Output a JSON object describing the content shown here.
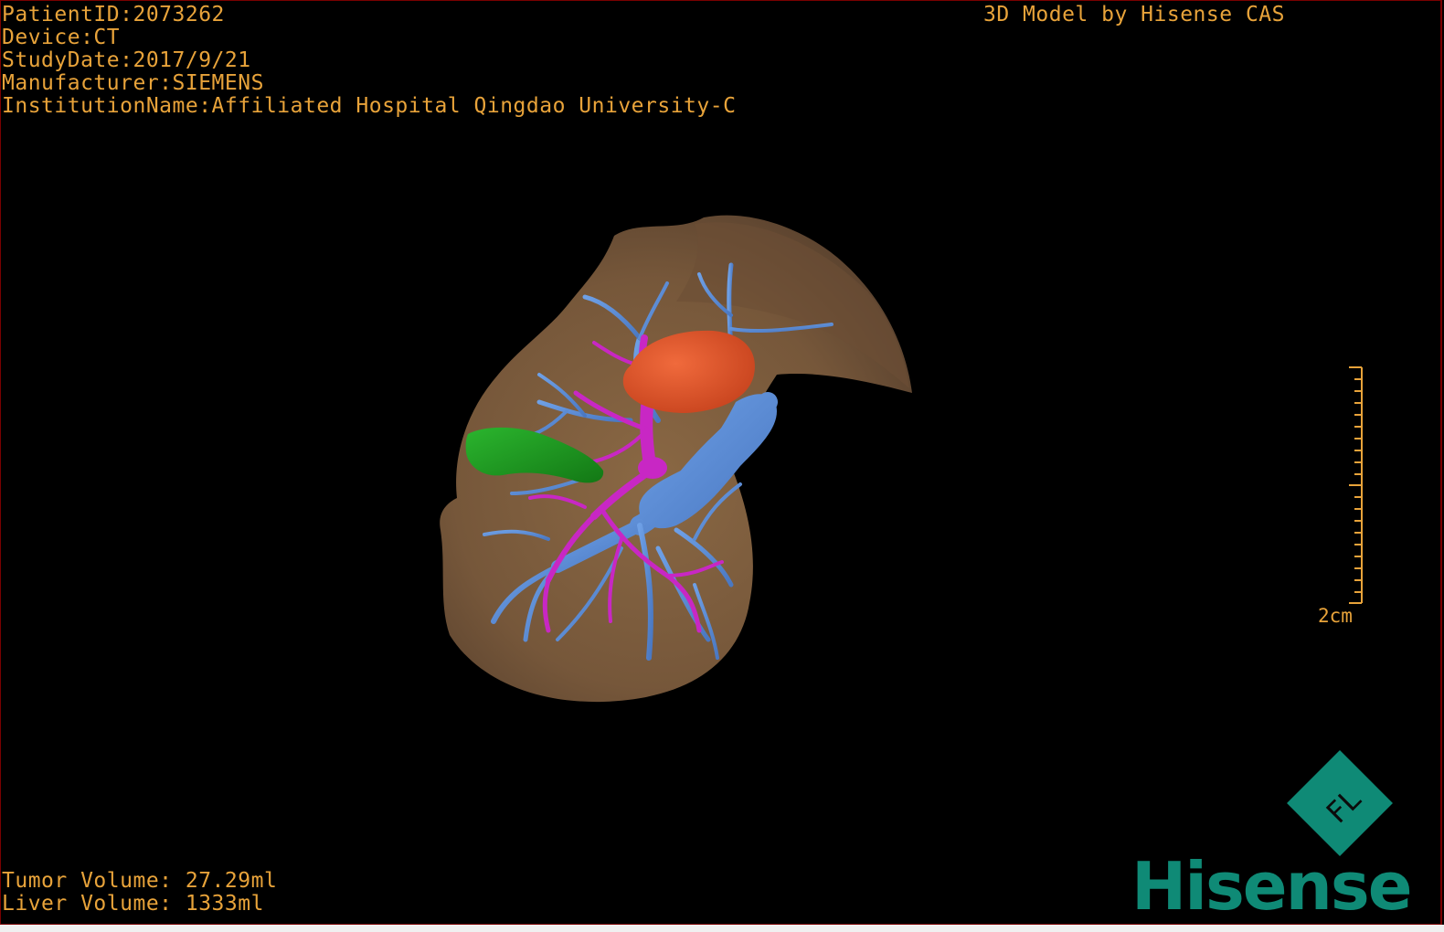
{
  "info": {
    "patient_id": "PatientID:2073262",
    "device": "Device:CT",
    "study_date": "StudyDate:2017/9/21",
    "manufacturer": "Manufacturer:SIEMENS",
    "institution": "InstitutionName:Affiliated Hospital Qingdao University-C"
  },
  "header_right": "3D Model by Hisense CAS",
  "volumes": {
    "tumor": "Tumor Volume: 27.29ml",
    "liver": "Liver Volume: 1333ml"
  },
  "scale_bar": {
    "label": "2cm"
  },
  "logo": {
    "word": "Hisense",
    "mark": "FL"
  },
  "colors": {
    "text": "#e8a33a",
    "liver": "#7a5a3c",
    "tumor": "#e0582f",
    "portal_vein": "#c827c4",
    "hepatic_vein": "#5b8fd8",
    "gallbladder": "#1f9a22",
    "brand": "#0f8a76"
  }
}
